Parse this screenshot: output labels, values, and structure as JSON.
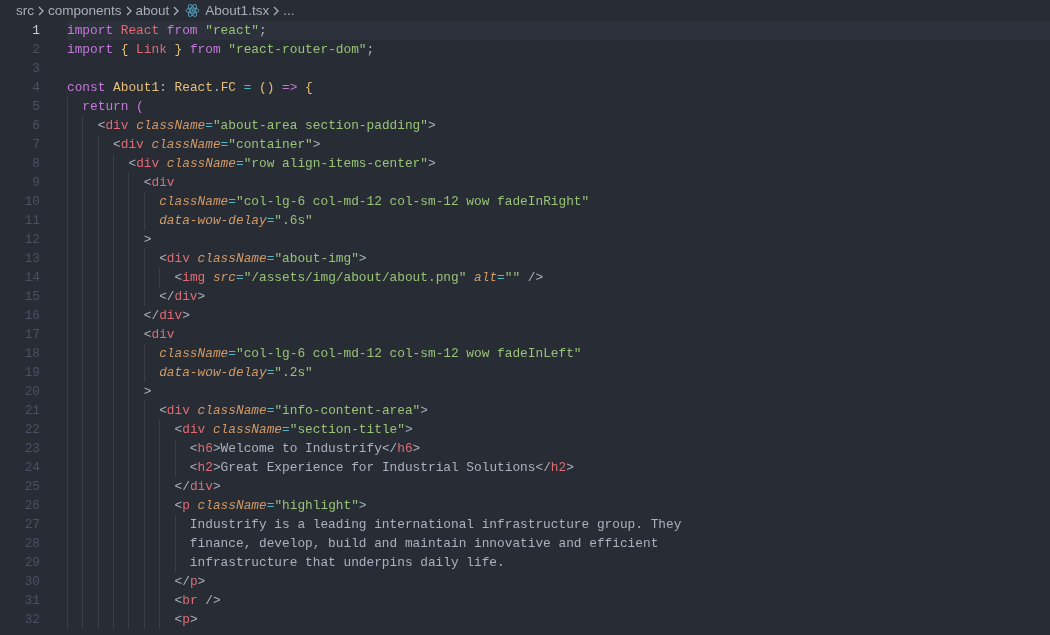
{
  "breadcrumb": [
    {
      "label": "src",
      "kind": "folder"
    },
    {
      "label": "components",
      "kind": "folder"
    },
    {
      "label": "about",
      "kind": "folder"
    },
    {
      "label": "About1.tsx",
      "kind": "file"
    },
    {
      "label": "...",
      "kind": "more"
    }
  ],
  "editor": {
    "lines": [
      {
        "number": "1",
        "current": true,
        "tokens": [
          {
            "kind": "keyword",
            "text": "import"
          },
          {
            "kind": "variable",
            "text": " React"
          },
          {
            "kind": "keyword",
            "text": " from"
          },
          {
            "kind": "string",
            "text": " \"react\""
          },
          {
            "kind": "punct",
            "text": ";"
          }
        ]
      },
      {
        "number": "2",
        "current": false,
        "tokens": [
          {
            "kind": "keyword",
            "text": "import"
          },
          {
            "kind": "bracket",
            "text": " {"
          },
          {
            "kind": "variable",
            "text": " Link"
          },
          {
            "kind": "bracket",
            "text": " }"
          },
          {
            "kind": "keyword",
            "text": " from"
          },
          {
            "kind": "string",
            "text": " \"react-router-dom\""
          },
          {
            "kind": "punct",
            "text": ";"
          }
        ]
      },
      {
        "number": "3",
        "current": false
      },
      {
        "number": "4",
        "current": false,
        "tokens": [
          {
            "kind": "keyword",
            "text": "const"
          },
          {
            "kind": "type",
            "text": " About1"
          },
          {
            "kind": "punct",
            "text": ":"
          },
          {
            "kind": "type",
            "text": " React"
          },
          {
            "kind": "punct",
            "text": "."
          },
          {
            "kind": "type",
            "text": "FC"
          },
          {
            "kind": "operator",
            "text": " ="
          },
          {
            "kind": "bracket",
            "text": " ()"
          },
          {
            "kind": "keyword",
            "text": " =>"
          },
          {
            "kind": "bracket",
            "text": " {"
          }
        ]
      },
      {
        "number": "5",
        "current": false,
        "tokens": [
          {
            "kind": "keyword",
            "text": "  return"
          },
          {
            "kind": "bracket2",
            "text": " ("
          }
        ]
      },
      {
        "number": "6",
        "current": false,
        "tokens": [
          {
            "kind": "punct",
            "text": "    <"
          },
          {
            "kind": "tag",
            "text": "div"
          },
          {
            "kind": "attr",
            "text": " className"
          },
          {
            "kind": "operator",
            "text": "="
          },
          {
            "kind": "string",
            "text": "\"about-area section-padding\""
          },
          {
            "kind": "punct",
            "text": ">"
          }
        ]
      },
      {
        "number": "7",
        "current": false,
        "tokens": [
          {
            "kind": "punct",
            "text": "      <"
          },
          {
            "kind": "tag",
            "text": "div"
          },
          {
            "kind": "attr",
            "text": " className"
          },
          {
            "kind": "operator",
            "text": "="
          },
          {
            "kind": "string",
            "text": "\"container\""
          },
          {
            "kind": "punct",
            "text": ">"
          }
        ]
      },
      {
        "number": "8",
        "current": false,
        "tokens": [
          {
            "kind": "punct",
            "text": "        <"
          },
          {
            "kind": "tag",
            "text": "div"
          },
          {
            "kind": "attr",
            "text": " className"
          },
          {
            "kind": "operator",
            "text": "="
          },
          {
            "kind": "string",
            "text": "\"row align-items-center\""
          },
          {
            "kind": "punct",
            "text": ">"
          }
        ]
      },
      {
        "number": "9",
        "current": false,
        "tokens": [
          {
            "kind": "punct",
            "text": "          <"
          },
          {
            "kind": "tag",
            "text": "div"
          }
        ]
      },
      {
        "number": "10",
        "current": false,
        "tokens": [
          {
            "kind": "attr",
            "text": "            className"
          },
          {
            "kind": "operator",
            "text": "="
          },
          {
            "kind": "string",
            "text": "\"col-lg-6 col-md-12 col-sm-12 wow fadeInRight\""
          }
        ]
      },
      {
        "number": "11",
        "current": false,
        "tokens": [
          {
            "kind": "attr",
            "text": "            data-wow-delay"
          },
          {
            "kind": "operator",
            "text": "="
          },
          {
            "kind": "string",
            "text": "\".6s\""
          }
        ]
      },
      {
        "number": "12",
        "current": false,
        "tokens": [
          {
            "kind": "punct",
            "text": "          >"
          }
        ]
      },
      {
        "number": "13",
        "current": false,
        "tokens": [
          {
            "kind": "punct",
            "text": "            <"
          },
          {
            "kind": "tag",
            "text": "div"
          },
          {
            "kind": "attr",
            "text": " className"
          },
          {
            "kind": "operator",
            "text": "="
          },
          {
            "kind": "string",
            "text": "\"about-img\""
          },
          {
            "kind": "punct",
            "text": ">"
          }
        ]
      },
      {
        "number": "14",
        "current": false,
        "tokens": [
          {
            "kind": "punct",
            "text": "              <"
          },
          {
            "kind": "tag",
            "text": "img"
          },
          {
            "kind": "attr",
            "text": " src"
          },
          {
            "kind": "operator",
            "text": "="
          },
          {
            "kind": "string",
            "text": "\"/assets/img/about/about.png\""
          },
          {
            "kind": "attr",
            "text": " alt"
          },
          {
            "kind": "operator",
            "text": "="
          },
          {
            "kind": "string",
            "text": "\"\""
          },
          {
            "kind": "punct",
            "text": " />"
          }
        ]
      },
      {
        "number": "15",
        "current": false,
        "tokens": [
          {
            "kind": "punct",
            "text": "            </"
          },
          {
            "kind": "tag",
            "text": "div"
          },
          {
            "kind": "punct",
            "text": ">"
          }
        ]
      },
      {
        "number": "16",
        "current": false,
        "tokens": [
          {
            "kind": "punct",
            "text": "          </"
          },
          {
            "kind": "tag",
            "text": "div"
          },
          {
            "kind": "punct",
            "text": ">"
          }
        ]
      },
      {
        "number": "17",
        "current": false,
        "tokens": [
          {
            "kind": "punct",
            "text": "          <"
          },
          {
            "kind": "tag",
            "text": "div"
          }
        ]
      },
      {
        "number": "18",
        "current": false,
        "tokens": [
          {
            "kind": "attr",
            "text": "            className"
          },
          {
            "kind": "operator",
            "text": "="
          },
          {
            "kind": "string",
            "text": "\"col-lg-6 col-md-12 col-sm-12 wow fadeInLeft\""
          }
        ]
      },
      {
        "number": "19",
        "current": false,
        "tokens": [
          {
            "kind": "attr",
            "text": "            data-wow-delay"
          },
          {
            "kind": "operator",
            "text": "="
          },
          {
            "kind": "string",
            "text": "\".2s\""
          }
        ]
      },
      {
        "number": "20",
        "current": false,
        "tokens": [
          {
            "kind": "punct",
            "text": "          >"
          }
        ]
      },
      {
        "number": "21",
        "current": false,
        "tokens": [
          {
            "kind": "punct",
            "text": "            <"
          },
          {
            "kind": "tag",
            "text": "div"
          },
          {
            "kind": "attr",
            "text": " className"
          },
          {
            "kind": "operator",
            "text": "="
          },
          {
            "kind": "string",
            "text": "\"info-content-area\""
          },
          {
            "kind": "punct",
            "text": ">"
          }
        ]
      },
      {
        "number": "22",
        "current": false,
        "tokens": [
          {
            "kind": "punct",
            "text": "              <"
          },
          {
            "kind": "tag",
            "text": "div"
          },
          {
            "kind": "attr",
            "text": " className"
          },
          {
            "kind": "operator",
            "text": "="
          },
          {
            "kind": "string",
            "text": "\"section-title\""
          },
          {
            "kind": "punct",
            "text": ">"
          }
        ]
      },
      {
        "number": "23",
        "current": false,
        "tokens": [
          {
            "kind": "punct",
            "text": "                <"
          },
          {
            "kind": "tag",
            "text": "h6"
          },
          {
            "kind": "punct",
            "text": ">"
          },
          {
            "kind": "plain",
            "text": "Welcome to Industrify"
          },
          {
            "kind": "punct",
            "text": "</"
          },
          {
            "kind": "tag",
            "text": "h6"
          },
          {
            "kind": "punct",
            "text": ">"
          }
        ]
      },
      {
        "number": "24",
        "current": false,
        "tokens": [
          {
            "kind": "punct",
            "text": "                <"
          },
          {
            "kind": "tag",
            "text": "h2"
          },
          {
            "kind": "punct",
            "text": ">"
          },
          {
            "kind": "plain",
            "text": "Great Experience for Industrial Solutions"
          },
          {
            "kind": "punct",
            "text": "</"
          },
          {
            "kind": "tag",
            "text": "h2"
          },
          {
            "kind": "punct",
            "text": ">"
          }
        ]
      },
      {
        "number": "25",
        "current": false,
        "tokens": [
          {
            "kind": "punct",
            "text": "              </"
          },
          {
            "kind": "tag",
            "text": "div"
          },
          {
            "kind": "punct",
            "text": ">"
          }
        ]
      },
      {
        "number": "26",
        "current": false,
        "tokens": [
          {
            "kind": "punct",
            "text": "              <"
          },
          {
            "kind": "tag",
            "text": "p"
          },
          {
            "kind": "attr",
            "text": " className"
          },
          {
            "kind": "operator",
            "text": "="
          },
          {
            "kind": "string",
            "text": "\"highlight\""
          },
          {
            "kind": "punct",
            "text": ">"
          }
        ]
      },
      {
        "number": "27",
        "current": false,
        "tokens": [
          {
            "kind": "plain",
            "text": "                Industrify is a leading international infrastructure group. They"
          }
        ]
      },
      {
        "number": "28",
        "current": false,
        "tokens": [
          {
            "kind": "plain",
            "text": "                finance, develop, build and maintain innovative and efficient"
          }
        ]
      },
      {
        "number": "29",
        "current": false,
        "tokens": [
          {
            "kind": "plain",
            "text": "                infrastructure that underpins daily life."
          }
        ]
      },
      {
        "number": "30",
        "current": false,
        "tokens": [
          {
            "kind": "punct",
            "text": "              </"
          },
          {
            "kind": "tag",
            "text": "p"
          },
          {
            "kind": "punct",
            "text": ">"
          }
        ]
      },
      {
        "number": "31",
        "current": false,
        "tokens": [
          {
            "kind": "punct",
            "text": "              <"
          },
          {
            "kind": "tag",
            "text": "br"
          },
          {
            "kind": "punct",
            "text": " />"
          }
        ]
      },
      {
        "number": "32",
        "current": false,
        "tokens": [
          {
            "kind": "punct",
            "text": "              <"
          },
          {
            "kind": "tag",
            "text": "p"
          },
          {
            "kind": "punct",
            "text": ">"
          }
        ]
      }
    ]
  }
}
